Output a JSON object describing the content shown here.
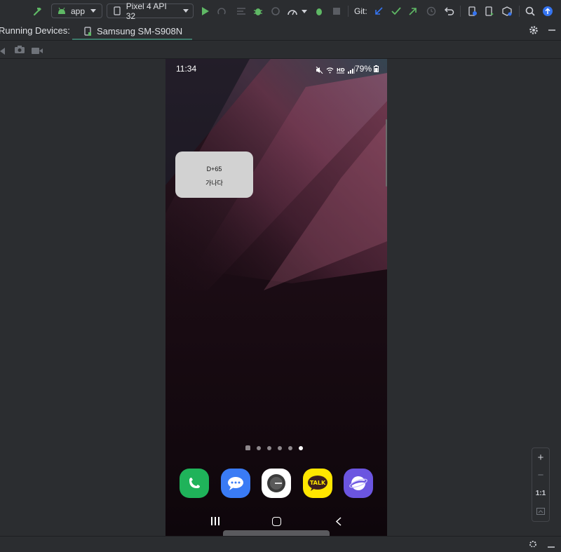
{
  "toolbar": {
    "run_config": "app",
    "device_selector": "Pixel 4 API 32",
    "git_label": "Git:"
  },
  "tabbar": {
    "title": "Running Devices:",
    "device_tab": "Samsung SM-S908N"
  },
  "phone": {
    "status": {
      "time": "11:34",
      "battery": "79%"
    },
    "widget": {
      "line1": "D+65",
      "line2": "가나다"
    },
    "page_dots_count": 6,
    "active_page_index": 5,
    "dock_apps": [
      {
        "name": "phone-app-icon",
        "color": "#1fb35a"
      },
      {
        "name": "messages-app-icon",
        "color": "#3a7bf5"
      },
      {
        "name": "clock-app-icon",
        "color": "#ffffff"
      },
      {
        "name": "kakaotalk-app-icon",
        "color": "#ffe600",
        "label": "TALK"
      },
      {
        "name": "internet-app-icon",
        "color": "#6b55e0"
      }
    ]
  },
  "zoom": {
    "zoom_in": "+",
    "zoom_out": "−",
    "actual_size": "1:1"
  },
  "colors": {
    "ide_bg": "#2b2d30",
    "accent_blue": "#3574f0",
    "run_green": "#5fb865"
  }
}
